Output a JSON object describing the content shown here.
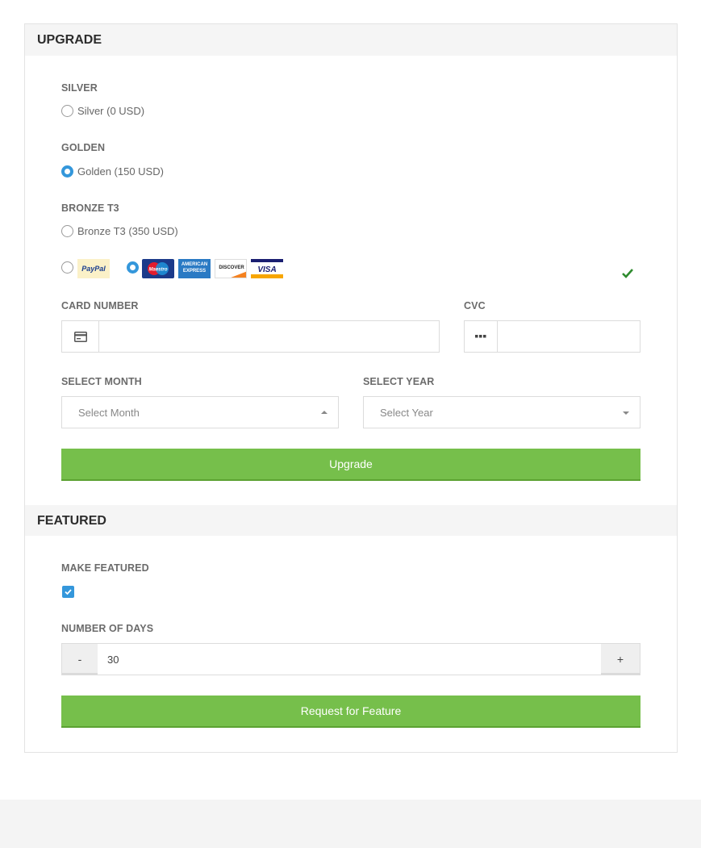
{
  "upgrade": {
    "title": "UPGRADE",
    "plans": [
      {
        "group_label": "SILVER",
        "option_label": "Silver (0 USD)",
        "selected": false
      },
      {
        "group_label": "GOLDEN",
        "option_label": "Golden (150 USD)",
        "selected": true
      },
      {
        "group_label": "BRONZE T3",
        "option_label": "Bronze T3 (350 USD)",
        "selected": false
      }
    ],
    "payment": {
      "paypal_label": "PayPal",
      "cards": [
        "Maestro",
        "AMERICAN EXPRESS",
        "DISCOVER",
        "VISA"
      ],
      "selected": "cards"
    },
    "card_number_label": "CARD NUMBER",
    "card_number_value": "",
    "cvc_label": "CVC",
    "cvc_value": "",
    "month_label": "SELECT MONTH",
    "month_placeholder": "Select Month",
    "year_label": "SELECT YEAR",
    "year_placeholder": "Select Year",
    "submit_label": "Upgrade"
  },
  "featured": {
    "title": "FEATURED",
    "make_featured_label": "MAKE FEATURED",
    "make_featured_checked": true,
    "days_label": "NUMBER OF DAYS",
    "days_value": "30",
    "minus_label": "-",
    "plus_label": "+",
    "submit_label": "Request for Feature"
  },
  "colors": {
    "accent_blue": "#3497db",
    "button_green": "#76bf4b",
    "check_green": "#2e8b2e"
  }
}
